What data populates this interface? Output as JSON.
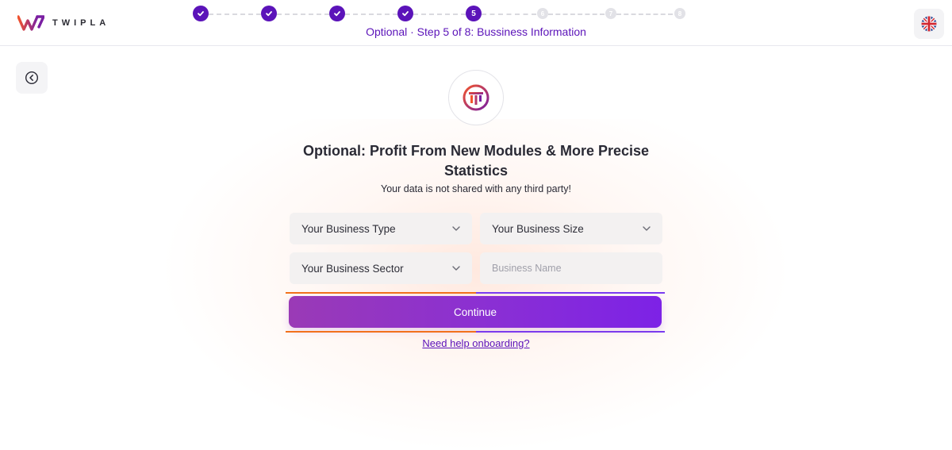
{
  "brand": {
    "name": "TWIPLA"
  },
  "stepper": {
    "steps": [
      {
        "state": "done",
        "label": ""
      },
      {
        "state": "done",
        "label": ""
      },
      {
        "state": "done",
        "label": ""
      },
      {
        "state": "done",
        "label": ""
      },
      {
        "state": "current",
        "label": "5"
      },
      {
        "state": "todo",
        "label": "6"
      },
      {
        "state": "todo",
        "label": "7"
      },
      {
        "state": "todo",
        "label": "8"
      }
    ],
    "caption": "Optional · Step 5 of 8: Bussiness Information"
  },
  "language": {
    "icon": "uk-flag-icon"
  },
  "back": {
    "icon": "back-arrow-icon"
  },
  "main": {
    "icon": "modules-icon",
    "title": "Optional: Profit From New Modules & More Precise Statistics",
    "subtitle": "Your data is not shared with any third party!",
    "fields": {
      "business_type": "Your Business Type",
      "business_size": "Your Business Size",
      "business_sector": "Your Business Sector",
      "business_name_placeholder": "Business Name"
    },
    "continue_label": "Continue",
    "help_link": "Need help onboarding?"
  },
  "colors": {
    "accent": "#5b13b9",
    "button_start": "#9a3ab6",
    "button_end": "#7d22e6",
    "orange": "#f2711c"
  }
}
